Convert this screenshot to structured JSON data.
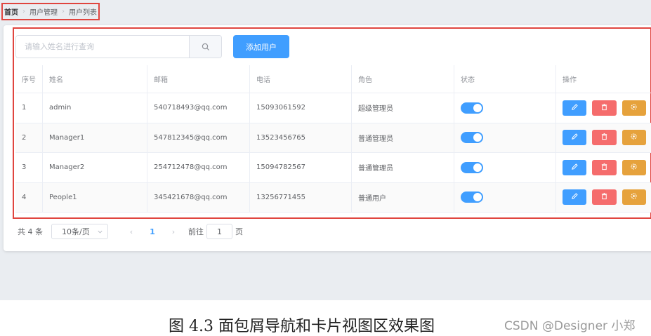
{
  "breadcrumb": [
    "首页",
    "用户管理",
    "用户列表"
  ],
  "search": {
    "placeholder": "请输入姓名进行查询"
  },
  "add_button": "添加用户",
  "table": {
    "headers": [
      "序号",
      "姓名",
      "邮箱",
      "电话",
      "角色",
      "状态",
      "操作"
    ],
    "rows": [
      {
        "index": "1",
        "name": "admin",
        "email": "540718493@qq.com",
        "phone": "15093061592",
        "role": "超级管理员",
        "status": true
      },
      {
        "index": "2",
        "name": "Manager1",
        "email": "547812345@qq.com",
        "phone": "13523456765",
        "role": "普通管理员",
        "status": true
      },
      {
        "index": "3",
        "name": "Manager2",
        "email": "254712478@qq.com",
        "phone": "15094782567",
        "role": "普通管理员",
        "status": true
      },
      {
        "index": "4",
        "name": "People1",
        "email": "345421678@qq.com",
        "phone": "13256771455",
        "role": "普通用户",
        "status": true
      }
    ]
  },
  "pagination": {
    "total": "共 4 条",
    "page_size": "10条/页",
    "current_page": "1",
    "goto_label": "前往",
    "goto_value": "1",
    "page_suffix": "页"
  },
  "caption": "图 4.3 面包屑导航和卡片视图区效果图",
  "watermark": "CSDN @Designer 小郑",
  "colors": {
    "primary": "#409eff",
    "danger": "#f56c6c",
    "warning": "#e6a23c",
    "highlight": "#e0453f"
  },
  "icons": {
    "search": "search-icon",
    "edit": "edit-icon",
    "delete": "delete-icon",
    "settings": "setting-icon"
  }
}
